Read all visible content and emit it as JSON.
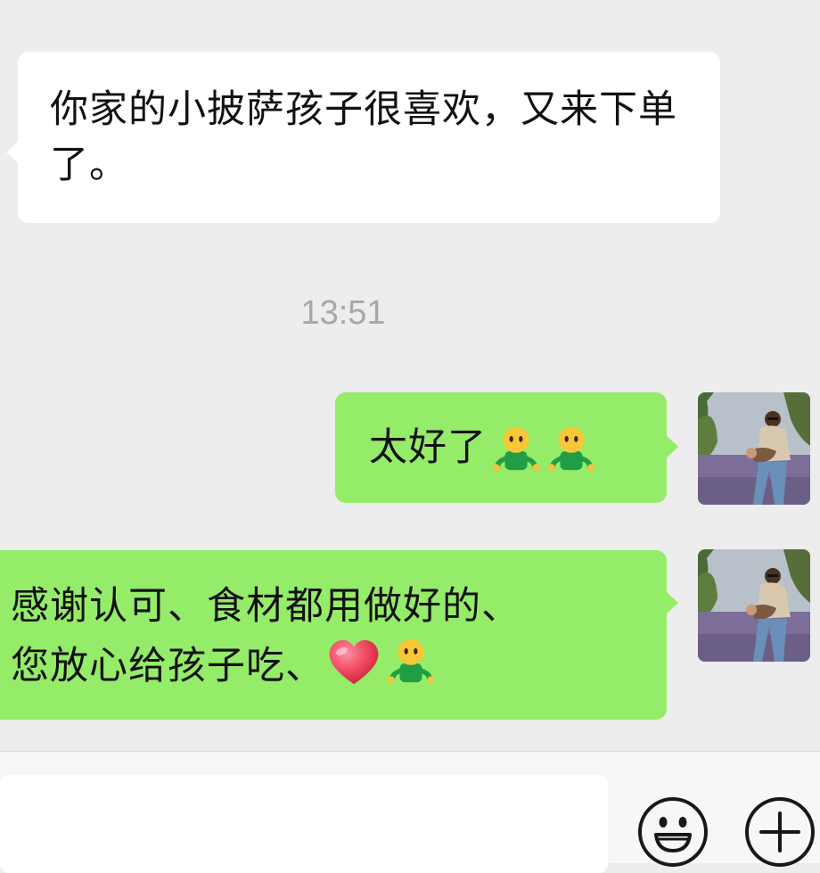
{
  "conversation": {
    "messages": [
      {
        "direction": "incoming",
        "text": "你家的小披萨孩子很喜欢，又来下单了。"
      },
      {
        "direction": "outgoing",
        "text": "太好了",
        "emojis": [
          "person-emoji",
          "person-emoji"
        ]
      },
      {
        "direction": "outgoing",
        "lines": [
          "感谢认可、食材都用做好的、",
          "您放心给孩子吃、"
        ],
        "emojis": [
          "red-heart-emoji",
          "person-emoji"
        ]
      }
    ],
    "timestamp": "13:51"
  },
  "input_bar": {
    "input_value": "",
    "buttons": [
      "emoji-icon",
      "plus-icon"
    ]
  },
  "colors": {
    "chat_background": "#ededed",
    "incoming_bubble": "#ffffff",
    "outgoing_bubble": "#95ec69",
    "timestamp_text": "#a7a7a7"
  }
}
